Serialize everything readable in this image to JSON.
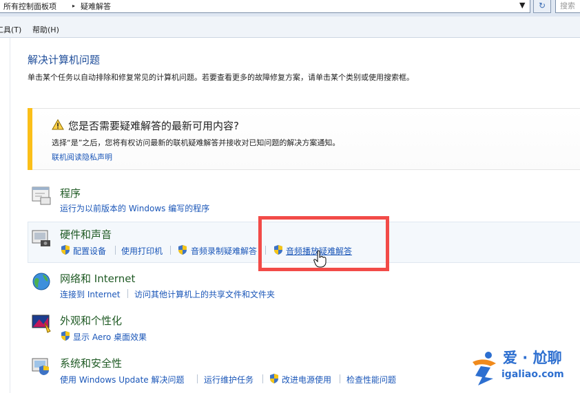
{
  "address_bar": {
    "crumb_1": "所有控制面板项",
    "crumb_sep": "▸",
    "crumb_2": "疑难解答",
    "search_placeholder": "搜索"
  },
  "menu": {
    "tools": "工具(T)",
    "help": "帮助(H)"
  },
  "page": {
    "title": "解决计算机问题",
    "subtitle": "单击某个任务以自动排除和修复常见的计算机问题。若要查看更多的故障修复方案，请单击某个类别或使用搜索框。"
  },
  "notice": {
    "heading": "您是否需要疑难解答的最新可用内容?",
    "body": "选择“是”之后，您将有权访问最新的联机疑难解答并接收对已知问题的解决方案通知。",
    "link": "联机阅读隐私声明"
  },
  "categories": [
    {
      "title": "程序",
      "links": [
        "运行为以前版本的 Windows 编写的程序"
      ]
    },
    {
      "title": "硬件和声音",
      "links": [
        "配置设备",
        "使用打印机",
        "音频录制疑难解答",
        "音频播放疑难解答"
      ]
    },
    {
      "title": "网络和 Internet",
      "links": [
        "连接到 Internet",
        "访问其他计算机上的共享文件和文件夹"
      ]
    },
    {
      "title": "外观和个性化",
      "links": [
        "显示 Aero 桌面效果"
      ]
    },
    {
      "title": "系统和安全性",
      "links": [
        "使用 Windows Update 解决问题",
        "运行维护任务",
        "改进电源使用",
        "检查性能问题"
      ]
    }
  ],
  "watermark": {
    "brand": "爱 · 尬聊",
    "url": "igaliao.com"
  },
  "colors": {
    "link": "#1a56b8",
    "category_title": "#1f5a24",
    "warning_bar": "#fbbf19",
    "highlight": "#f24b48"
  }
}
